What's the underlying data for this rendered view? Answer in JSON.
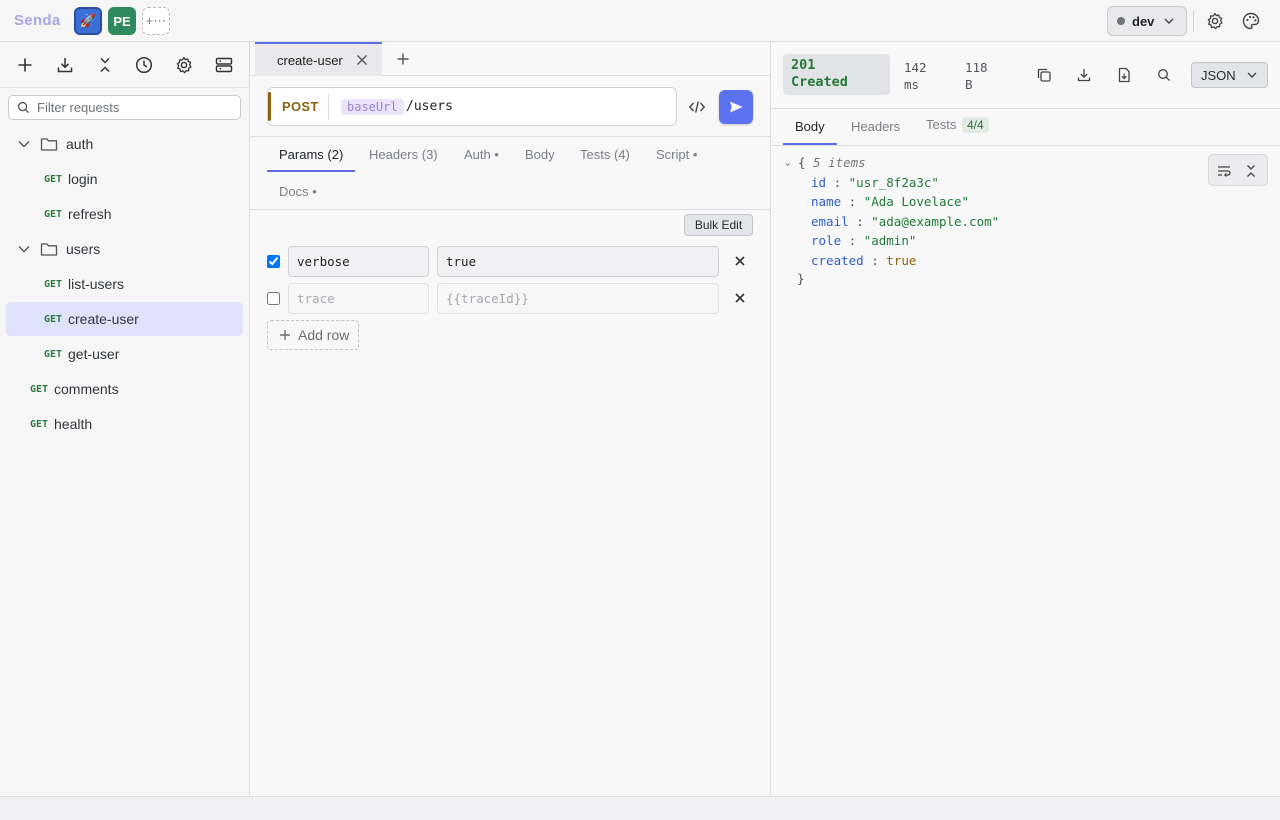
{
  "app": {
    "brand": "Senda"
  },
  "workspaces": [
    {
      "label": "🚀"
    },
    {
      "label": "PE"
    },
    {
      "label": "+⋯"
    }
  ],
  "environment": {
    "name": "dev"
  },
  "sidebar": {
    "filter_placeholder": "Filter requests",
    "tree": [
      {
        "type": "folder",
        "label": "auth"
      },
      {
        "type": "request",
        "method": "GET",
        "label": "login"
      },
      {
        "type": "request",
        "method": "GET",
        "label": "refresh"
      },
      {
        "type": "folder",
        "label": "users"
      },
      {
        "type": "request",
        "method": "GET",
        "label": "list-users"
      },
      {
        "type": "request",
        "method": "GET",
        "label": "create-user",
        "active": true
      },
      {
        "type": "request",
        "method": "GET",
        "label": "get-user"
      },
      {
        "type": "request",
        "method": "GET",
        "label": "comments"
      },
      {
        "type": "request",
        "method": "GET",
        "label": "health"
      }
    ]
  },
  "request": {
    "tab_label": "create-user",
    "method": "POST",
    "url_variable": "baseUrl",
    "url_path": "/users",
    "tabs": [
      "Params (2)",
      "Headers (3)",
      "Auth •",
      "Body",
      "Tests (4)",
      "Script •",
      "Docs •"
    ],
    "bulk_edit_label": "Bulk Edit",
    "params": [
      {
        "enabled": true,
        "key": "verbose",
        "value": "true"
      },
      {
        "enabled": false,
        "key": "",
        "value": "",
        "key_placeholder": "trace",
        "value_placeholder": "{{traceId}}"
      }
    ],
    "add_row_label": "Add row"
  },
  "response": {
    "status_code": "201",
    "status_text": "Created",
    "time_value": "142",
    "time_unit": "ms",
    "size_value": "118",
    "size_unit": "B",
    "format": "JSON",
    "tabs": {
      "body": "Body",
      "headers": "Headers",
      "tests": "Tests",
      "tests_badge": "4/4"
    },
    "json": {
      "summary": "5 items",
      "fields": [
        {
          "key": "id",
          "value": "\"usr_8f2a3c\"",
          "kind": "string"
        },
        {
          "key": "name",
          "value": "\"Ada Lovelace\"",
          "kind": "string"
        },
        {
          "key": "email",
          "value": "\"ada@example.com\"",
          "kind": "string"
        },
        {
          "key": "role",
          "value": "\"admin\"",
          "kind": "string"
        },
        {
          "key": "created",
          "value": "true",
          "kind": "boolean"
        }
      ]
    }
  },
  "colors": {
    "accent": "#5b6ee8",
    "method_get": "#2c7a3f",
    "method_post": "#8a6210",
    "status_success": "#237a36"
  }
}
